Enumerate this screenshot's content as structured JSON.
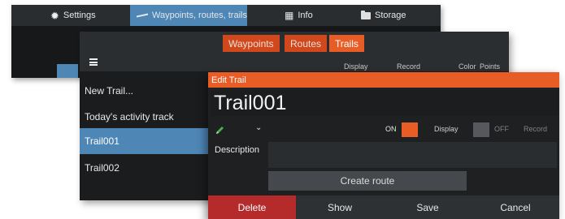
{
  "top_toolbar": {
    "tabs": [
      {
        "label": "Settings",
        "icon": "gear-icon"
      },
      {
        "label": "Waypoints, routes, trails",
        "icon": "waypoint-route-icon",
        "active": true
      },
      {
        "label": "Info",
        "icon": "info-icon"
      },
      {
        "label": "Storage",
        "icon": "folder-icon"
      }
    ]
  },
  "list_panel": {
    "tabs": [
      {
        "label": "Waypoints"
      },
      {
        "label": "Routes"
      },
      {
        "label": "Trails",
        "active": true
      }
    ],
    "menu_icon": "hamburger-menu-icon",
    "columns": [
      "Display",
      "Record",
      "Color",
      "Points"
    ],
    "items": [
      {
        "label": "New Trail..."
      },
      {
        "label": "Today's activity track"
      },
      {
        "label": "Trail001",
        "selected": true
      },
      {
        "label": "Trail002"
      }
    ]
  },
  "edit_dialog": {
    "title": "Edit Trail",
    "name_value": "Trail001",
    "color_icon": "pencil-icon",
    "color_value": "#4caf50",
    "display_on_label": "ON",
    "display_label": "Display",
    "record_off_label": "OFF",
    "record_label": "Record",
    "description_label": "Description",
    "description_value": "",
    "create_route_label": "Create route",
    "buttons": {
      "delete": "Delete",
      "show": "Show",
      "save": "Save",
      "cancel": "Cancel"
    }
  },
  "colors": {
    "accent_orange": "#e85c26",
    "selection_blue": "#4e86b6",
    "delete_red": "#b52a2a"
  }
}
